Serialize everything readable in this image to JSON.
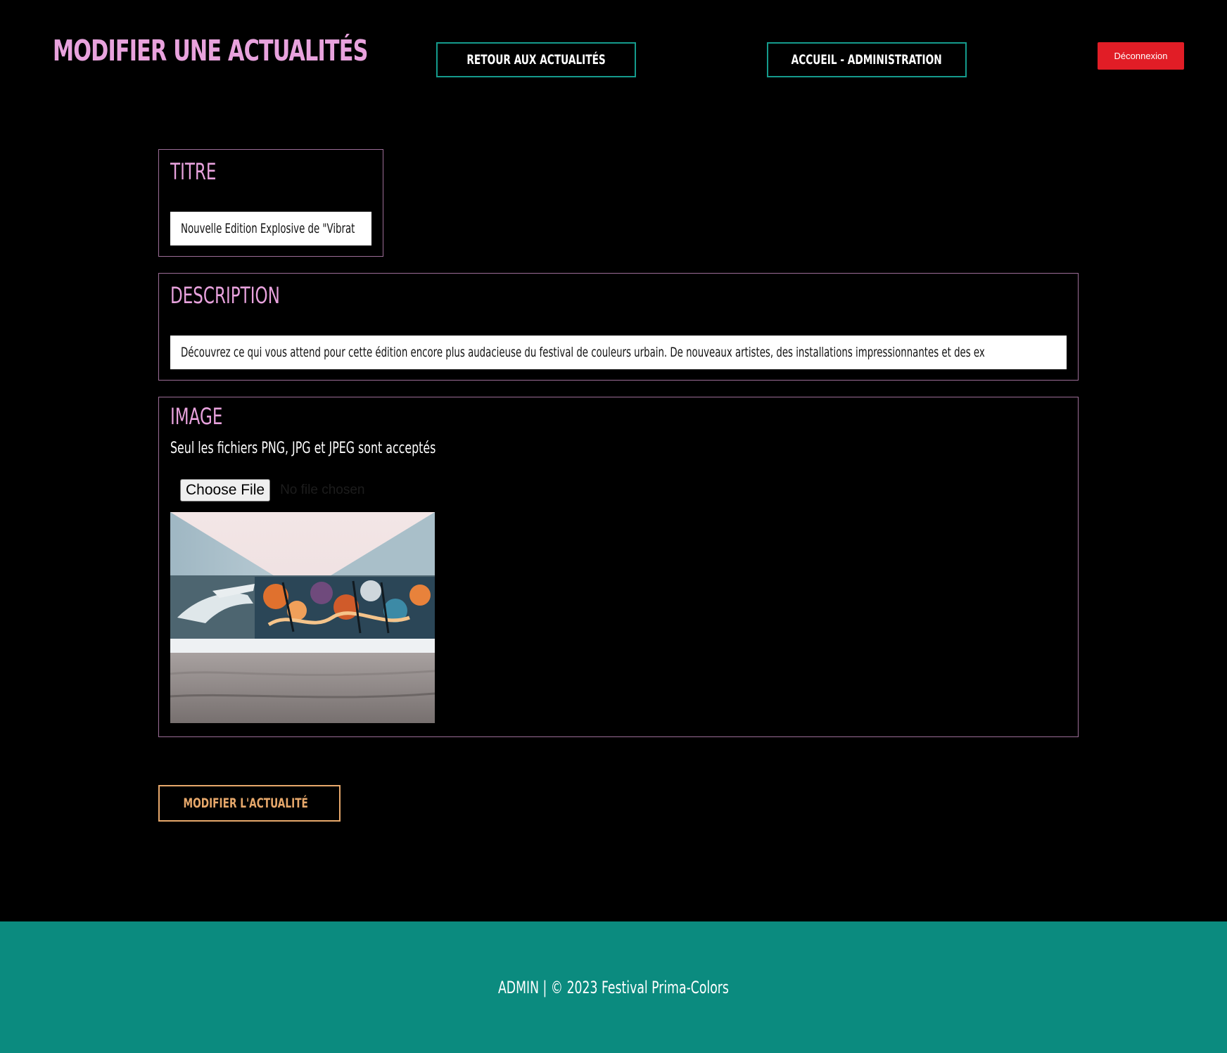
{
  "header": {
    "title": "MODIFIER UNE ACTUALITÉS",
    "back_label": "RETOUR AUX ACTUALITÉS",
    "home_label": "ACCUEIL - ADMINISTRATION",
    "logout_label": "Déconnexion"
  },
  "form": {
    "titre": {
      "label": "TITRE",
      "value": "Nouvelle Edition Explosive de \"Vibrat"
    },
    "description": {
      "label": "DESCRIPTION",
      "value": "Découvrez ce qui vous attend pour cette édition encore plus audacieuse du festival de couleurs urbain. De nouveaux artistes, des installations impressionnantes et des ex"
    },
    "image": {
      "label": "IMAGE",
      "help": "Seul les fichiers PNG, JPG et JPEG sont acceptés",
      "choose_label": "Choose File",
      "file_status": "No file chosen"
    },
    "submit_label": "MODIFIER L'ACTUALITÉ",
    "submit_icon": "pencil-icon"
  },
  "footer": {
    "text": "ADMIN | © 2023 Festival Prima-Colors"
  },
  "colors": {
    "background": "#000000",
    "title_pink": "#e8a2dd",
    "teal": "#159b8c",
    "footer_teal": "#0b8b7f",
    "logout_red": "#e11d26",
    "submit_orange": "#e7a86b"
  }
}
